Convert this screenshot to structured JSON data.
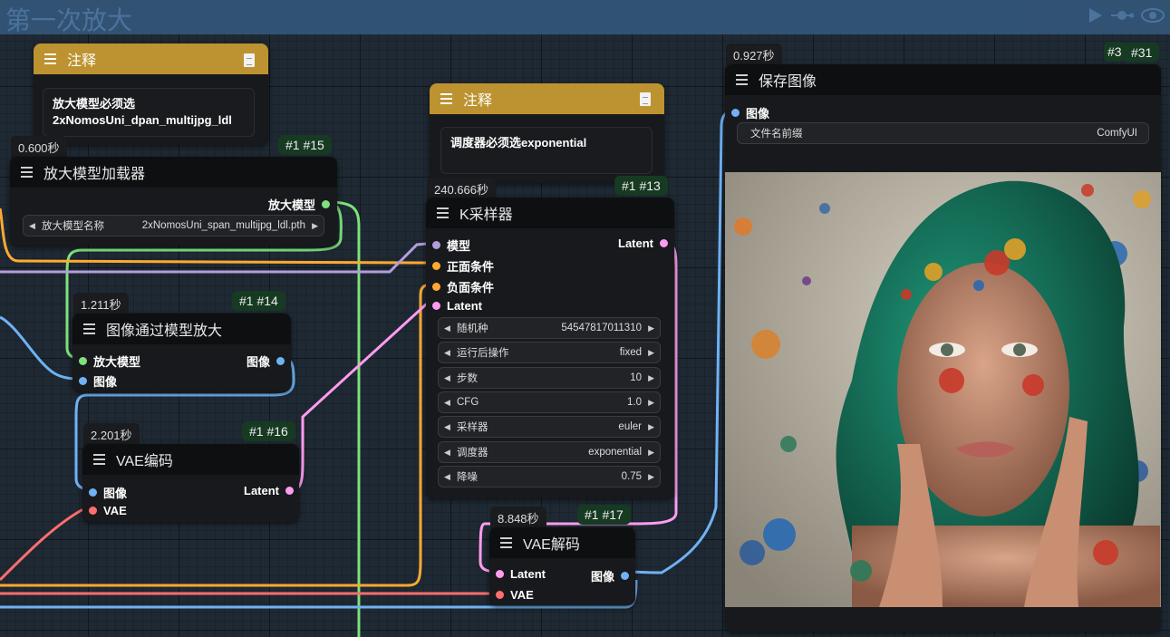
{
  "group": {
    "title": "第一次放大"
  },
  "notes": [
    {
      "title": "注释",
      "text": "放大模型必须选\n2xNomosUni_dpan_multijpg_ldl"
    },
    {
      "title": "注释",
      "text": "调度器必须选exponential"
    }
  ],
  "upscale_loader": {
    "time": "0.600秒",
    "id": "#1 #15",
    "title": "放大模型加载器",
    "output": "放大模型",
    "widget_label": "放大模型名称",
    "widget_value": "2xNomosUni_span_multijpg_ldl.pth"
  },
  "upscale_image": {
    "time": "1.211秒",
    "id": "#1 #14",
    "title": "图像通过模型放大",
    "in_model": "放大模型",
    "in_image": "图像",
    "out_image": "图像"
  },
  "vae_encode": {
    "time": "2.201秒",
    "id": "#1 #16",
    "title": "VAE编码",
    "in_image": "图像",
    "in_vae": "VAE",
    "out_latent": "Latent"
  },
  "ksampler": {
    "time": "240.666秒",
    "id": "#1 #13",
    "title": "K采样器",
    "in_model": "模型",
    "in_positive": "正面条件",
    "in_negative": "负面条件",
    "in_latent": "Latent",
    "out_latent": "Latent",
    "widgets": [
      {
        "label": "随机种",
        "value": "54547817011310"
      },
      {
        "label": "运行后操作",
        "value": "fixed"
      },
      {
        "label": "步数",
        "value": "10"
      },
      {
        "label": "CFG",
        "value": "1.0"
      },
      {
        "label": "采样器",
        "value": "euler"
      },
      {
        "label": "调度器",
        "value": "exponential"
      },
      {
        "label": "降噪",
        "value": "0.75"
      }
    ]
  },
  "vae_decode": {
    "time": "8.848秒",
    "id": "#1 #17",
    "title": "VAE解码",
    "in_latent": "Latent",
    "in_vae": "VAE",
    "out_image": "图像"
  },
  "save_image": {
    "time": "0.927秒",
    "id": "#31",
    "id_extra": "#3",
    "title": "保存图像",
    "in_image": "图像",
    "widget_label": "文件名前缀",
    "widget_value": "ComfyUI"
  },
  "colors": {
    "model": "#7ee27c",
    "image": "#6fb2f5",
    "latent": "#ff9cf0",
    "vae": "#ff6e6e",
    "conditioning": "#ffa931",
    "clip_model": "#b39ddb"
  },
  "icons": [
    "play-icon",
    "link-icon",
    "eye-icon",
    "document-icon",
    "menu-icon"
  ]
}
